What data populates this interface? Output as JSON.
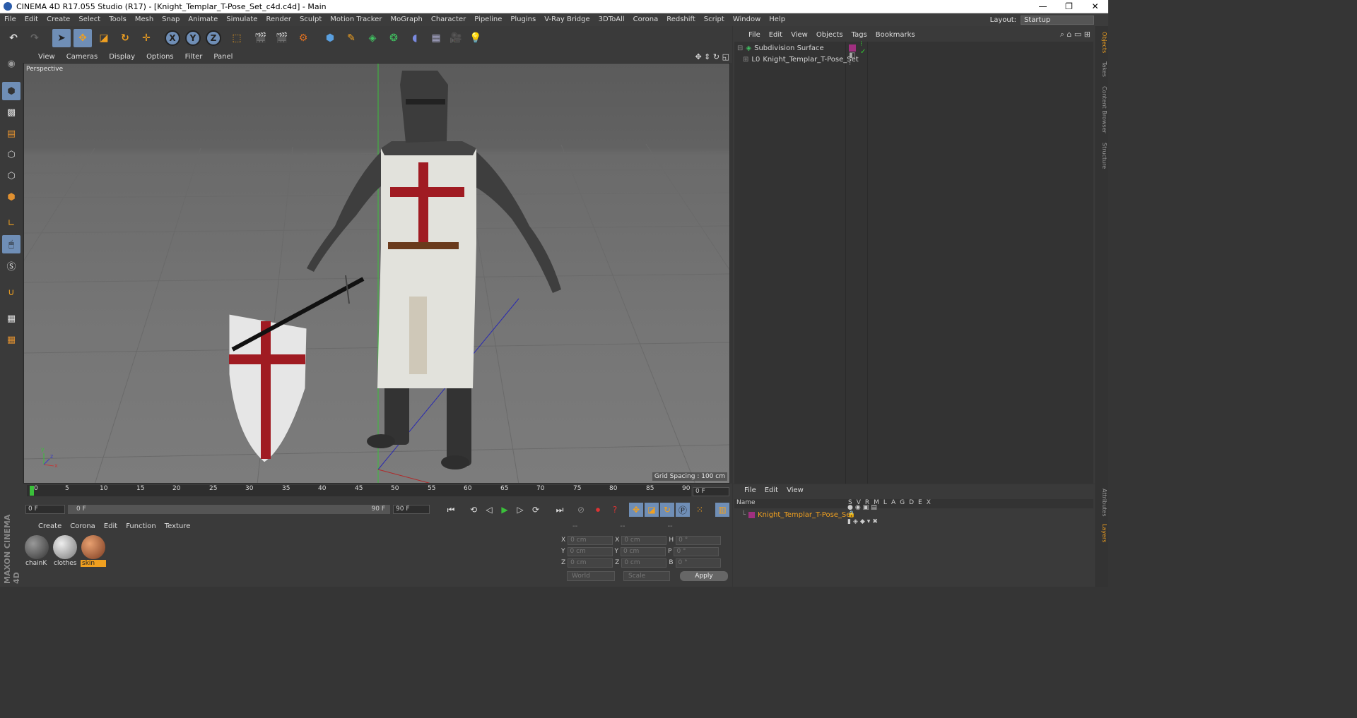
{
  "window": {
    "title": "CINEMA 4D R17.055 Studio (R17) - [Knight_Templar_T-Pose_Set_c4d.c4d] - Main",
    "controls": [
      "—",
      "❐",
      "✕"
    ]
  },
  "menubar": {
    "items": [
      "File",
      "Edit",
      "Create",
      "Select",
      "Tools",
      "Mesh",
      "Snap",
      "Animate",
      "Simulate",
      "Render",
      "Sculpt",
      "Motion Tracker",
      "MoGraph",
      "Character",
      "Pipeline",
      "Plugins",
      "V-Ray Bridge",
      "3DToAll",
      "Corona",
      "Redshift",
      "Script",
      "Window",
      "Help"
    ],
    "layout_label": "Layout:",
    "layout_value": "Startup"
  },
  "toolbar": {
    "xyz": [
      "X",
      "Y",
      "Z"
    ]
  },
  "viewport": {
    "menu": [
      "View",
      "Cameras",
      "Display",
      "Options",
      "Filter",
      "Panel"
    ],
    "label": "Perspective",
    "grid_spacing": "Grid Spacing : 100 cm",
    "axis": {
      "x": "x",
      "y": "y",
      "z": "z"
    }
  },
  "objects": {
    "menu": [
      "File",
      "Edit",
      "View",
      "Objects",
      "Tags",
      "Bookmarks"
    ],
    "rows": [
      {
        "name": "Subdivision Surface"
      },
      {
        "name": "Knight_Templar_T-Pose_Set"
      }
    ]
  },
  "side_tabs": [
    "Objects",
    "Takes",
    "Content Browser",
    "Structure",
    "Attributes",
    "Layers"
  ],
  "timeline": {
    "ticks": [
      "0",
      "5",
      "10",
      "15",
      "20",
      "25",
      "30",
      "35",
      "40",
      "45",
      "50",
      "55",
      "60",
      "65",
      "70",
      "75",
      "80",
      "85",
      "90"
    ],
    "end_field": "0 F",
    "start": "0 F",
    "range_start": "0 F",
    "range_end": "90 F",
    "end": "90 F"
  },
  "materials": {
    "menu": [
      "Create",
      "Corona",
      "Edit",
      "Function",
      "Texture"
    ],
    "items": [
      {
        "name": "chainK"
      },
      {
        "name": "clothes"
      },
      {
        "name": "skin"
      }
    ]
  },
  "coords": {
    "headers": [
      "--",
      "--",
      "--"
    ],
    "rows": [
      {
        "a": "X",
        "av": "0 cm",
        "b": "X",
        "bv": "0 cm",
        "c": "H",
        "cv": "0 °"
      },
      {
        "a": "Y",
        "av": "0 cm",
        "b": "Y",
        "bv": "0 cm",
        "c": "P",
        "cv": "0 °"
      },
      {
        "a": "Z",
        "av": "0 cm",
        "b": "Z",
        "bv": "0 cm",
        "c": "B",
        "cv": "0 °"
      }
    ],
    "mode1": "World",
    "mode2": "Scale",
    "apply": "Apply"
  },
  "layers": {
    "menu": [
      "File",
      "Edit",
      "View"
    ],
    "header_name": "Name",
    "cols": [
      "S",
      "V",
      "R",
      "M",
      "L",
      "A",
      "G",
      "D",
      "E",
      "X"
    ],
    "row": "Knight_Templar_T-Pose_Set"
  },
  "brand": "MAXON CINEMA 4D"
}
